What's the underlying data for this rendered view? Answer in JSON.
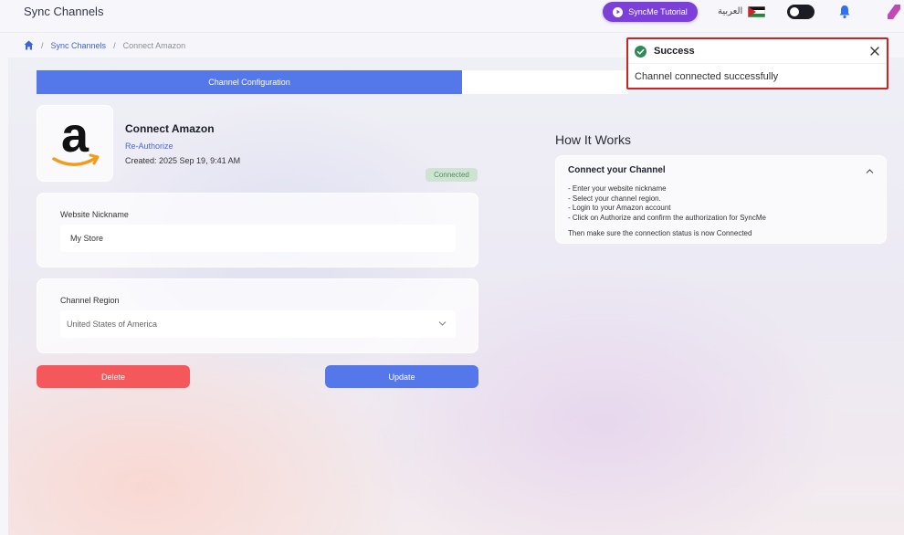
{
  "header": {
    "app_title": "Sync Channels",
    "tutorial_label": "SyncMe Tutorial",
    "language_label": "العربية"
  },
  "breadcrumb": {
    "link": "Sync Channels",
    "current": "Connect Amazon"
  },
  "tabs": {
    "active_label": "Channel Configuration"
  },
  "channel": {
    "name": "Connect Amazon",
    "reauthorize_label": "Re-Authorize",
    "created": "Created: 2025 Sep 19, 9:41 AM",
    "status": "Connected",
    "logo_icon": "amazon-logo"
  },
  "nickname": {
    "label": "Website Nickname",
    "value": "My Store"
  },
  "region": {
    "label": "Channel Region",
    "value": "United States of America"
  },
  "actions": {
    "delete_label": "Delete",
    "update_label": "Update"
  },
  "how_it_works": {
    "title": "How It Works",
    "section_title": "Connect your Channel",
    "steps": [
      "Enter your website nickname",
      "Select your channel region.",
      "Login to your Amazon account",
      "Click on Authorize and confirm the authorization for SyncMe"
    ],
    "note": "Then make sure the connection status is now Connected"
  },
  "toast": {
    "title": "Success",
    "message": "Channel connected successfully"
  },
  "colors": {
    "primary": "#5477ea",
    "danger": "#f5585a",
    "tutorial": "#7c3fd8",
    "success_badge_bg": "#cfe3d3",
    "success_badge_text": "#4f8e5f",
    "toast_border": "#d32020"
  }
}
